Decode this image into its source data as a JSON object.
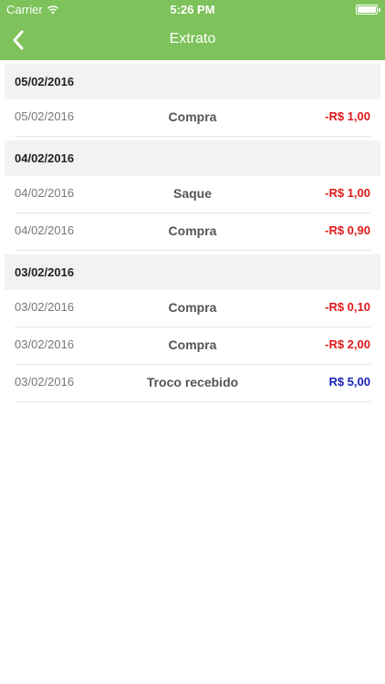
{
  "status": {
    "carrier": "Carrier",
    "time": "5:26 PM"
  },
  "nav": {
    "title": "Extrato",
    "back_icon": "chevron-left-icon"
  },
  "colors": {
    "header_green": "#7dc25a",
    "negative": "#e01a1a",
    "positive": "#1a22b8"
  },
  "groups": [
    {
      "date": "05/02/2016",
      "items": [
        {
          "date": "05/02/2016",
          "desc": "Compra",
          "amount": "-R$ 1,00",
          "type": "neg"
        }
      ]
    },
    {
      "date": "04/02/2016",
      "items": [
        {
          "date": "04/02/2016",
          "desc": "Saque",
          "amount": "-R$ 1,00",
          "type": "neg"
        },
        {
          "date": "04/02/2016",
          "desc": "Compra",
          "amount": "-R$ 0,90",
          "type": "neg"
        }
      ]
    },
    {
      "date": "03/02/2016",
      "items": [
        {
          "date": "03/02/2016",
          "desc": "Compra",
          "amount": "-R$ 0,10",
          "type": "neg"
        },
        {
          "date": "03/02/2016",
          "desc": "Compra",
          "amount": "-R$ 2,00",
          "type": "neg"
        },
        {
          "date": "03/02/2016",
          "desc": "Troco recebido",
          "amount": "R$ 5,00",
          "type": "pos"
        }
      ]
    }
  ]
}
